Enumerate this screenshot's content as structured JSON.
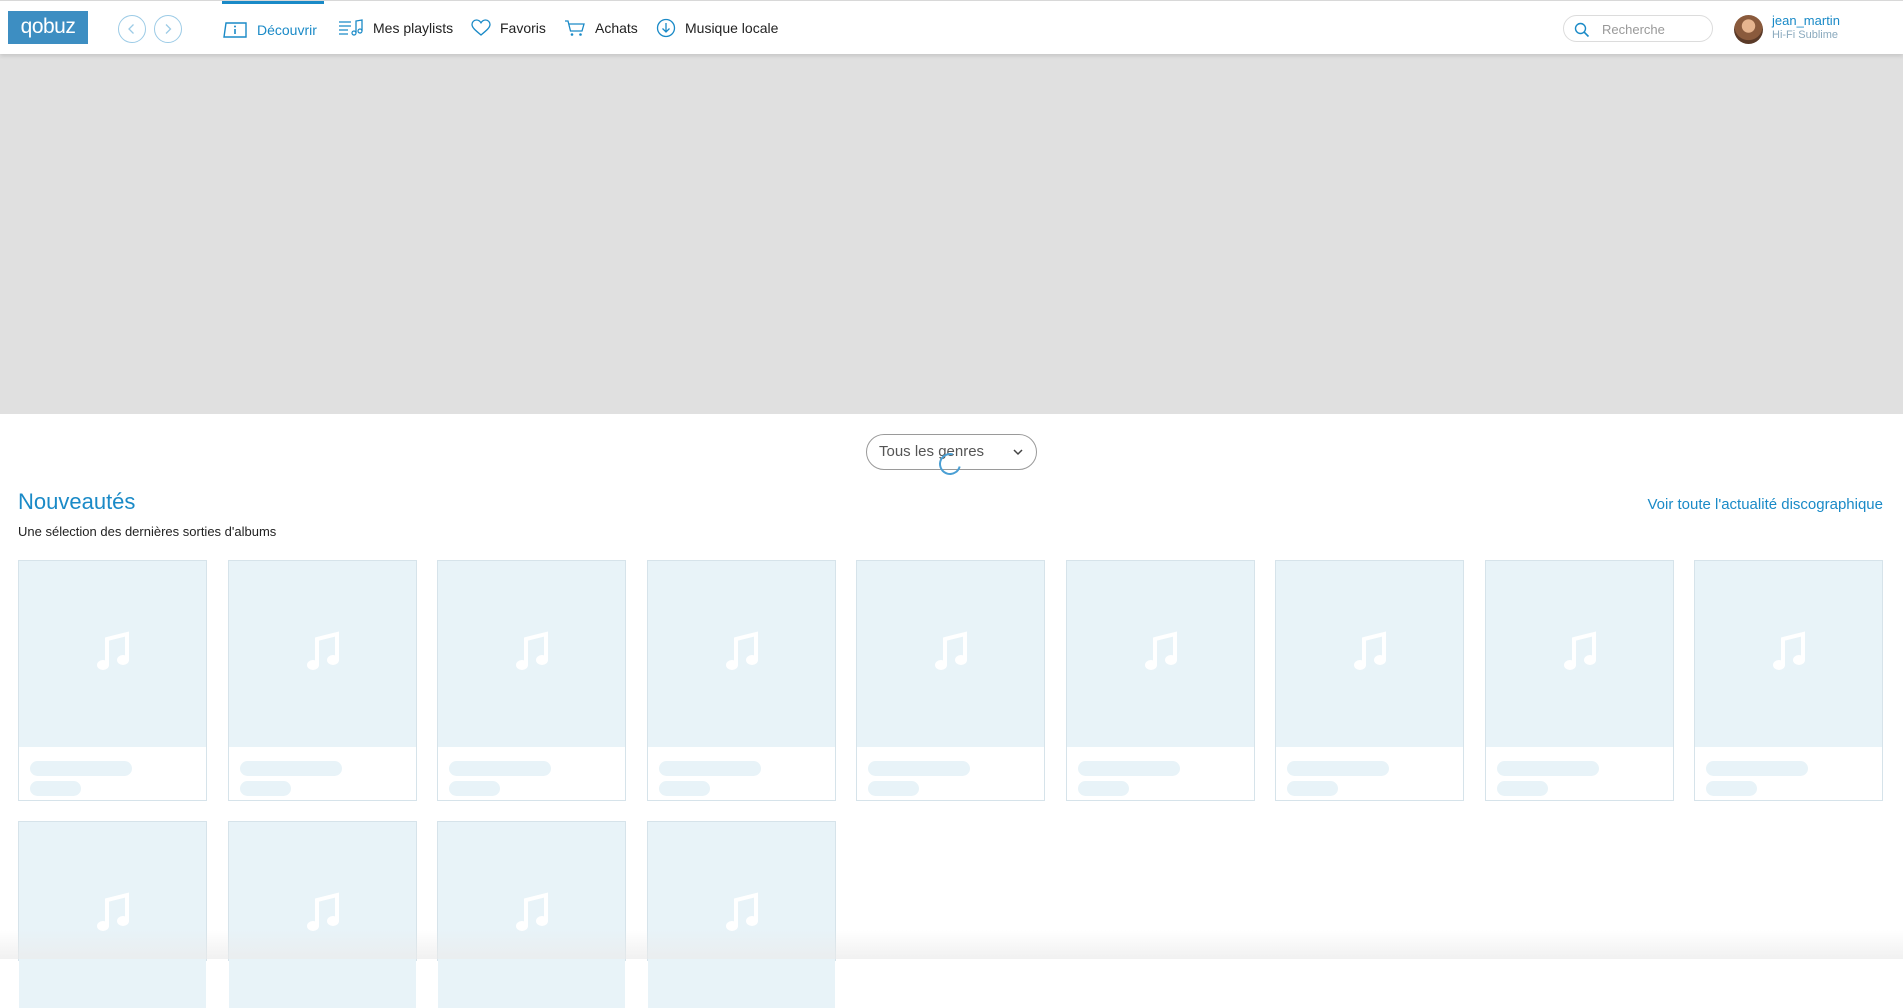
{
  "topbar": {
    "logo": "qobuz",
    "nav": [
      {
        "label": "Découvrir",
        "icon": "discover-icon",
        "active": true
      },
      {
        "label": "Mes playlists",
        "icon": "playlist-icon",
        "active": false
      },
      {
        "label": "Favoris",
        "icon": "heart-icon",
        "active": false
      },
      {
        "label": "Achats",
        "icon": "cart-icon",
        "active": false
      },
      {
        "label": "Musique locale",
        "icon": "download-icon",
        "active": false
      }
    ],
    "search_placeholder": "Recherche",
    "user": {
      "name": "jean_martin",
      "plan": "Hi-Fi Sublime"
    }
  },
  "genre_select": {
    "value": "Tous les genres"
  },
  "section": {
    "title": "Nouveautés",
    "subtitle": "Une sélection des dernières sorties d'albums",
    "see_all": "Voir toute l'actualité discographique"
  },
  "colors": {
    "accent": "#1a8ac7",
    "hero_placeholder": "#e0e0e0",
    "card_placeholder": "#e8f3f8"
  }
}
